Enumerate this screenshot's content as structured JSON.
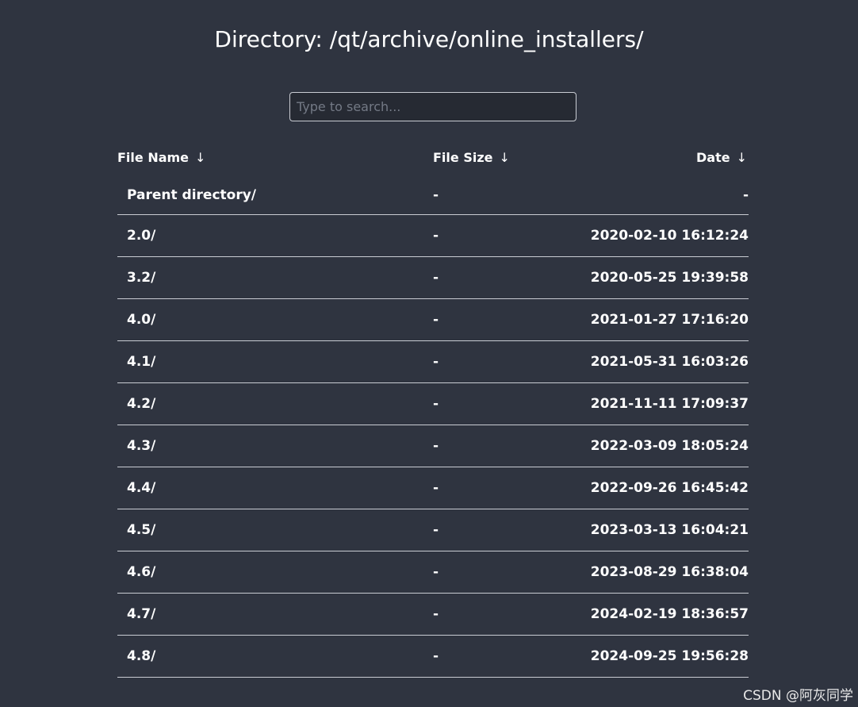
{
  "title": "Directory: /qt/archive/online_installers/",
  "search": {
    "placeholder": "Type to search..."
  },
  "columns": {
    "name": "File Name",
    "size": "File Size",
    "date": "Date",
    "sort_arrow": "↓"
  },
  "rows": [
    {
      "name": "Parent directory/",
      "size": "-",
      "date": "-"
    },
    {
      "name": "2.0/",
      "size": "-",
      "date": "2020-02-10 16:12:24"
    },
    {
      "name": "3.2/",
      "size": "-",
      "date": "2020-05-25 19:39:58"
    },
    {
      "name": "4.0/",
      "size": "-",
      "date": "2021-01-27 17:16:20"
    },
    {
      "name": "4.1/",
      "size": "-",
      "date": "2021-05-31 16:03:26"
    },
    {
      "name": "4.2/",
      "size": "-",
      "date": "2021-11-11 17:09:37"
    },
    {
      "name": "4.3/",
      "size": "-",
      "date": "2022-03-09 18:05:24"
    },
    {
      "name": "4.4/",
      "size": "-",
      "date": "2022-09-26 16:45:42"
    },
    {
      "name": "4.5/",
      "size": "-",
      "date": "2023-03-13 16:04:21"
    },
    {
      "name": "4.6/",
      "size": "-",
      "date": "2023-08-29 16:38:04"
    },
    {
      "name": "4.7/",
      "size": "-",
      "date": "2024-02-19 18:36:57"
    },
    {
      "name": "4.8/",
      "size": "-",
      "date": "2024-09-25 19:56:28"
    }
  ],
  "watermark": "CSDN @阿灰同学",
  "colors": {
    "background": "#2f3440",
    "text": "#ffffff",
    "divider": "#c9ccd3",
    "input_background": "#262a33"
  }
}
